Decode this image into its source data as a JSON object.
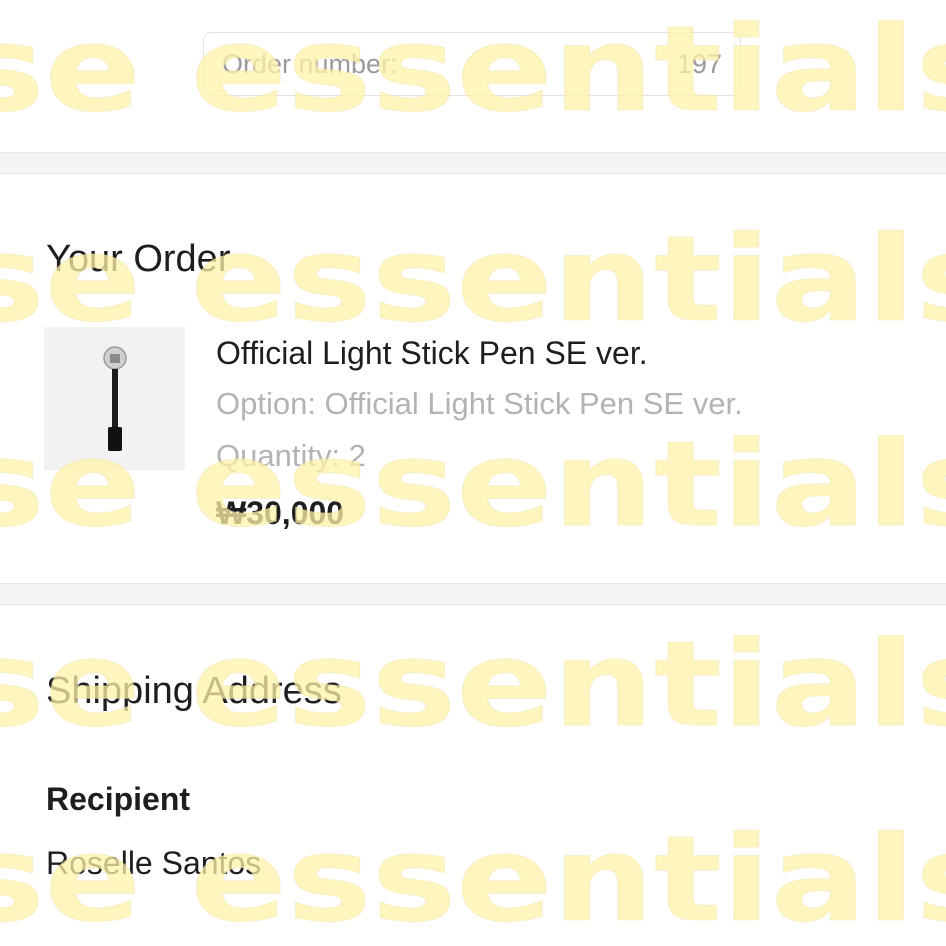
{
  "order": {
    "number_label": "Order number:",
    "number_value": "197"
  },
  "your_order": {
    "title": "Your Order",
    "item": {
      "name": "Official Light Stick Pen SE ver.",
      "option": "Option: Official Light Stick Pen SE ver.",
      "quantity": "Quantity: 2",
      "price": "₩30,000",
      "image_icon": "light-stick-pen"
    }
  },
  "shipping": {
    "title": "Shipping Address",
    "recipient_label": "Recipient",
    "recipient_value": "Roselle Santos"
  },
  "watermark": {
    "text": "se essentials",
    "color": "#fff3b0"
  }
}
